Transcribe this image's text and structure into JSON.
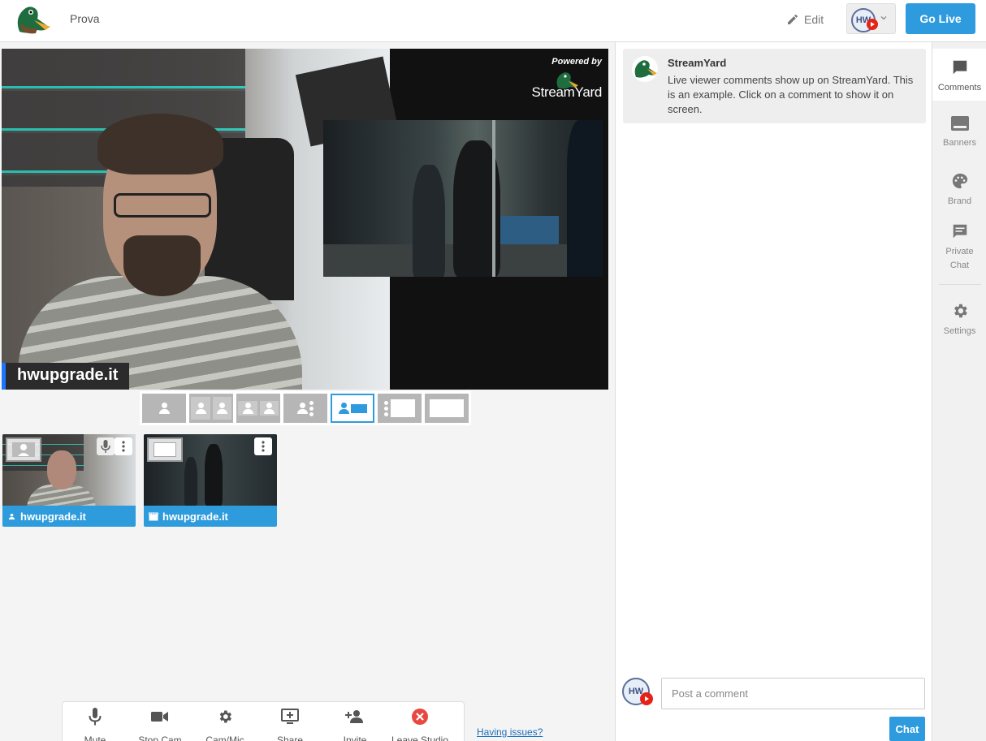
{
  "header": {
    "broadcast_title": "Prova",
    "edit_label": "Edit",
    "destination_avatar_text": "HW",
    "go_live_label": "Go Live"
  },
  "stage": {
    "name_tag": "hwupgrade.it",
    "powered_by_label": "Powered by",
    "powered_by_brand": "StreamYard"
  },
  "layouts": {
    "active_index": 4,
    "items": [
      "solo",
      "cropped-2",
      "group-2",
      "group-dots",
      "picture-in-picture",
      "leader-screen",
      "full-screen"
    ]
  },
  "participants": [
    {
      "name": "hwupgrade.it",
      "type": "camera",
      "icon": "person-icon"
    },
    {
      "name": "hwupgrade.it",
      "type": "screen",
      "icon": "clapperboard-icon"
    }
  ],
  "toolbar": {
    "mute_label": "Mute",
    "stop_cam_label": "Stop Cam",
    "cam_mic_label": "Cam/Mic",
    "share_label": "Share",
    "invite_label": "Invite",
    "leave_label": "Leave Studio"
  },
  "having_issues_label": "Having issues?",
  "chat": {
    "comment": {
      "author": "StreamYard",
      "text": "Live viewer comments show up on StreamYard. This is an example. Click on a comment to show it on screen."
    },
    "composer_avatar_text": "HW",
    "input_placeholder": "Post a comment",
    "send_label": "Chat"
  },
  "rail": {
    "items": [
      {
        "label": "Comments",
        "icon": "comment-icon",
        "active": true
      },
      {
        "label": "Banners",
        "icon": "banner-icon",
        "active": false
      },
      {
        "label": "Brand",
        "icon": "palette-icon",
        "active": false
      },
      {
        "label": "Private Chat",
        "icon": "chat-icon",
        "active": false
      },
      {
        "label": "Settings",
        "icon": "gear-icon",
        "active": false
      }
    ]
  },
  "colors": {
    "accent": "#2f9bdf",
    "leave_red": "#e8483f",
    "name_tag_bar": "#1e74ff",
    "youtube_red": "#e62117"
  }
}
